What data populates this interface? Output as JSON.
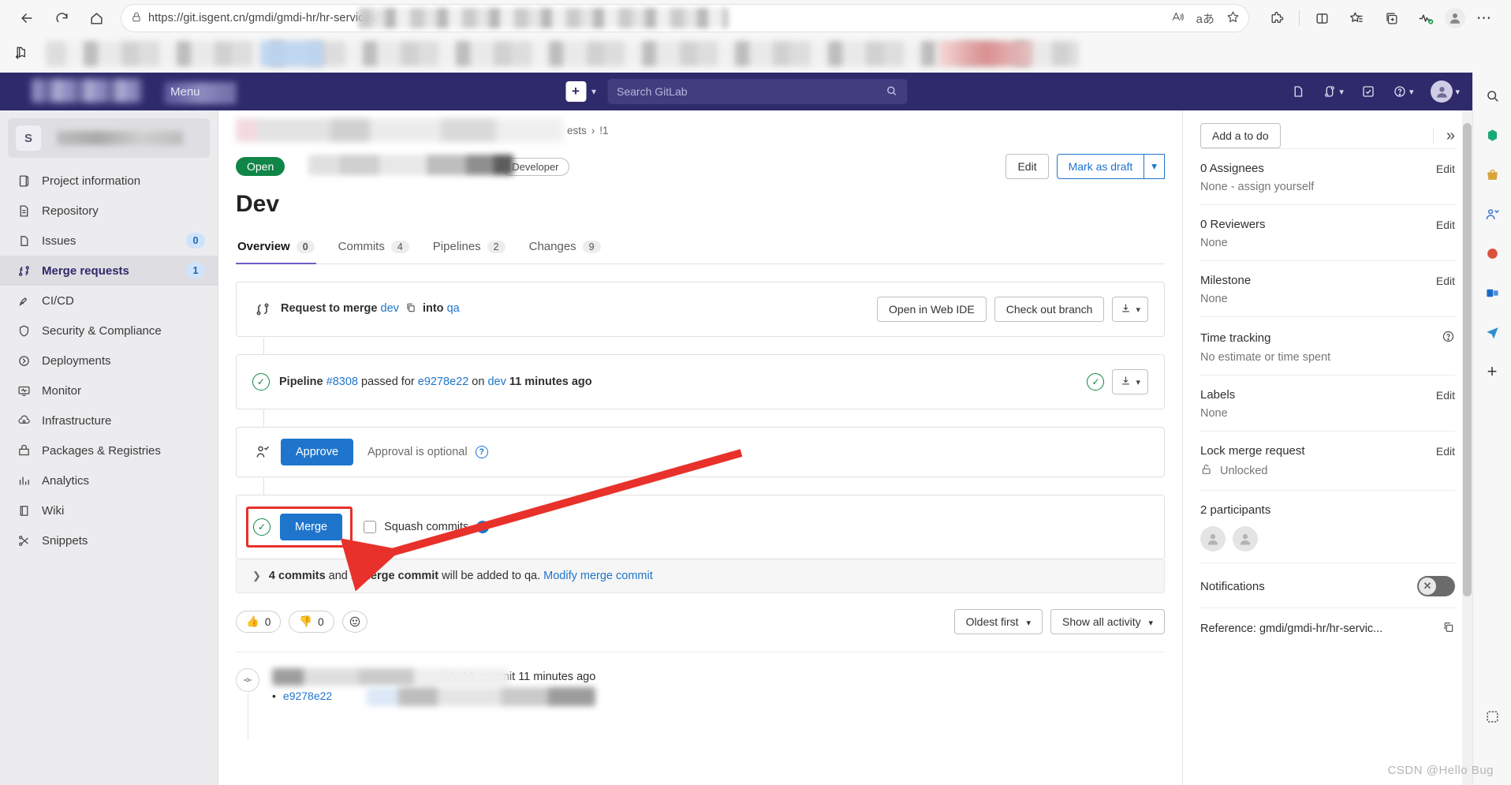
{
  "browser": {
    "url_text": "https://git.isgent.cn/gmdi/gmdi-hr/hr-services/",
    "back_icon": "back-arrow-icon",
    "reload_icon": "reload-icon",
    "home_icon": "home-icon",
    "lock_icon": "lock-icon",
    "read_aloud_icon": "read-aloud-icon",
    "translate_icon": "translate-icon",
    "favorite_icon": "star-icon",
    "extensions_icon": "extensions-icon",
    "split_screen_icon": "split-screen-icon",
    "collections_icon": "collections-icon",
    "add_tab_icon": "add-to-collection-icon",
    "performance_icon": "browser-essentials-icon",
    "profile_icon": "profile-icon",
    "settings_icon": "settings-more-icon",
    "bookmark_folder_icon": "bookmark-folder-icon"
  },
  "gitlab_nav": {
    "menu_label": "Menu",
    "search_placeholder": "Search GitLab",
    "create_new_icon": "plus-square-icon",
    "issues_icon": "issues-icon",
    "merge_requests_icon": "merge-request-icon",
    "todos_icon": "todo-icon",
    "help_icon": "help-icon",
    "avatar_icon": "user-avatar-icon"
  },
  "sidebar": {
    "project_initial": "S",
    "items": [
      {
        "label": "Project information",
        "icon": "project-info-icon",
        "badge": "",
        "active": false
      },
      {
        "label": "Repository",
        "icon": "repository-icon",
        "badge": "",
        "active": false
      },
      {
        "label": "Issues",
        "icon": "issues-icon",
        "badge": "0",
        "active": false
      },
      {
        "label": "Merge requests",
        "icon": "merge-request-icon",
        "badge": "1",
        "active": true
      },
      {
        "label": "CI/CD",
        "icon": "rocket-icon",
        "badge": "",
        "active": false
      },
      {
        "label": "Security & Compliance",
        "icon": "shield-icon",
        "badge": "",
        "active": false
      },
      {
        "label": "Deployments",
        "icon": "deployments-icon",
        "badge": "",
        "active": false
      },
      {
        "label": "Monitor",
        "icon": "monitor-icon",
        "badge": "",
        "active": false
      },
      {
        "label": "Infrastructure",
        "icon": "infrastructure-icon",
        "badge": "",
        "active": false
      },
      {
        "label": "Packages & Registries",
        "icon": "package-icon",
        "badge": "",
        "active": false
      },
      {
        "label": "Analytics",
        "icon": "analytics-icon",
        "badge": "",
        "active": false
      },
      {
        "label": "Wiki",
        "icon": "wiki-icon",
        "badge": "",
        "active": false
      },
      {
        "label": "Snippets",
        "icon": "snippets-icon",
        "badge": "",
        "active": false
      }
    ]
  },
  "main": {
    "breadcrumb_tail": "ests",
    "breadcrumb_separator": "›",
    "breadcrumb_id": "!1",
    "state_badge": "Open",
    "role_badge": "Developer",
    "edit_button": "Edit",
    "mark_draft_button": "Mark as draft",
    "title": "Dev",
    "tabs": [
      {
        "label": "Overview",
        "count": "0",
        "active": true
      },
      {
        "label": "Commits",
        "count": "4",
        "active": false
      },
      {
        "label": "Pipelines",
        "count": "2",
        "active": false
      },
      {
        "label": "Changes",
        "count": "9",
        "active": false
      }
    ],
    "merge_widget": {
      "request_prefix": "Request to merge",
      "source_branch": "dev",
      "into_label": "into",
      "target_branch": "qa",
      "copy_icon": "copy-branch-icon",
      "web_ide_button": "Open in Web IDE",
      "checkout_button": "Check out branch",
      "download_icon": "download-icon"
    },
    "pipeline_widget": {
      "prefix": "Pipeline",
      "pipeline_id": "#8308",
      "status_text": "passed for",
      "commit_sha": "e9278e22",
      "on_label": "on",
      "branch": "dev",
      "time": "11 minutes ago",
      "status_icon": "check-circle-icon",
      "download_icon": "download-icon"
    },
    "approve_widget": {
      "icon": "approval-check-icon",
      "button": "Approve",
      "note": "Approval is optional",
      "help_icon": "help-circle-icon"
    },
    "merge_action": {
      "status_icon": "check-circle-icon",
      "button": "Merge",
      "squash_label": "Squash commits",
      "help_icon": "help-circle-icon"
    },
    "commits_bar": {
      "chevron_icon": "chevron-right-icon",
      "commits_count": "4 commits",
      "and_label": "and",
      "merge_commit": "1 merge commit",
      "tail": "will be added to qa.",
      "modify_link": "Modify merge commit"
    },
    "reactions": [
      {
        "emoji": "👍",
        "count": "0",
        "name": "thumbs-up-reaction"
      },
      {
        "emoji": "👎",
        "count": "0",
        "name": "thumbs-down-reaction"
      }
    ],
    "add_reaction_icon": "add-emoji-icon",
    "sort_dropdown": "Oldest first",
    "filter_dropdown": "Show all activity",
    "activity": {
      "dot_icon": "commit-dot-icon",
      "text": "added 1 commit 11 minutes ago",
      "commit_sha": "e9278e22"
    }
  },
  "right_sidebar": {
    "todo_button": "Add a to do",
    "collapse_icon": "collapse-sidebar-icon",
    "blocks": [
      {
        "title": "0 Assignees",
        "action": "Edit",
        "value": "None - assign yourself",
        "name": "assignees"
      },
      {
        "title": "0 Reviewers",
        "action": "Edit",
        "value": "None",
        "name": "reviewers"
      },
      {
        "title": "Milestone",
        "action": "Edit",
        "value": "None",
        "name": "milestone"
      },
      {
        "title": "Time tracking",
        "action": "help-circle-icon",
        "value": "No estimate or time spent",
        "name": "time-tracking"
      },
      {
        "title": "Labels",
        "action": "Edit",
        "value": "None",
        "name": "labels"
      },
      {
        "title": "Lock merge request",
        "action": "Edit",
        "value": "Unlocked",
        "name": "lock-merge-request"
      }
    ],
    "participants_title": "2 participants",
    "notifications_label": "Notifications",
    "notifications_state": "off",
    "reference_label": "Reference: gmdi/gmdi-hr/hr-servic...",
    "copy_icon": "copy-reference-icon"
  },
  "watermark": "CSDN @Hello Bug"
}
